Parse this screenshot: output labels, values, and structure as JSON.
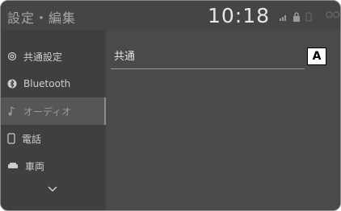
{
  "header": {
    "title": "設定・編集",
    "clock": "10:18"
  },
  "sidebar": {
    "items": [
      {
        "label": "共通設定",
        "icon": "gear-icon"
      },
      {
        "label": "Bluetooth",
        "icon": "bluetooth-icon"
      },
      {
        "label": "オーディオ",
        "icon": "music-note-icon"
      },
      {
        "label": "電話",
        "icon": "phone-icon"
      },
      {
        "label": "車両",
        "icon": "car-icon"
      }
    ],
    "selected_index": 2
  },
  "main": {
    "row_label": "共通"
  },
  "callout": {
    "label": "A"
  },
  "colors": {
    "background": "#4a4a4a",
    "sidebar": "#3f3f3f",
    "selected": "#565656"
  }
}
